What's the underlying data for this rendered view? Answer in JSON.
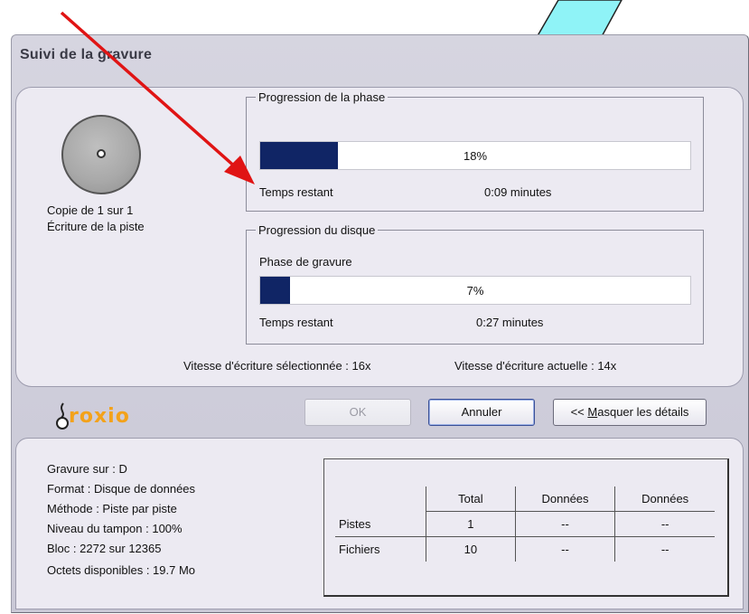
{
  "window": {
    "title": "Suivi de la gravure"
  },
  "status": {
    "copy": "Copie de 1 sur 1",
    "action": "Écriture de la piste"
  },
  "phase": {
    "legend": "Progression de la phase",
    "percent_label": "18%",
    "progress": 0.18,
    "remaining_label": "Temps restant",
    "remaining_value": "0:09 minutes"
  },
  "disc_progress": {
    "legend": "Progression du disque",
    "stage": "Phase de gravure",
    "percent_label": "7%",
    "progress": 0.07,
    "remaining_label": "Temps restant",
    "remaining_value": "0:27 minutes"
  },
  "speed": {
    "selected": "Vitesse d'écriture sélectionnée : 16x",
    "current": "Vitesse d'écriture actuelle : 14x"
  },
  "brand": {
    "logo_text": "roxio"
  },
  "buttons": {
    "ok": "OK",
    "cancel": "Annuler",
    "hide_prefix": "<< ",
    "hide_underlined": "M",
    "hide_rest": "asquer les détails"
  },
  "details": {
    "drive": "Gravure sur : D",
    "format": "Format : Disque de données",
    "method": "Méthode : Piste par piste",
    "buffer": "Niveau du tampon :  100%",
    "block": "Bloc :   2272 sur 12365",
    "free": "Octets disponibles :  19.7 Mo"
  },
  "stats_table": {
    "headers": [
      "",
      "Total",
      "Données",
      "Données"
    ],
    "rows": [
      [
        "Pistes",
        "1",
        "--",
        "--"
      ],
      [
        "Fichiers",
        "10",
        "--",
        "--"
      ]
    ]
  },
  "colors": {
    "progress_fill": "#102565",
    "annotation_arrow": "#e01414",
    "annotation_shape": "#8ff3f7"
  }
}
